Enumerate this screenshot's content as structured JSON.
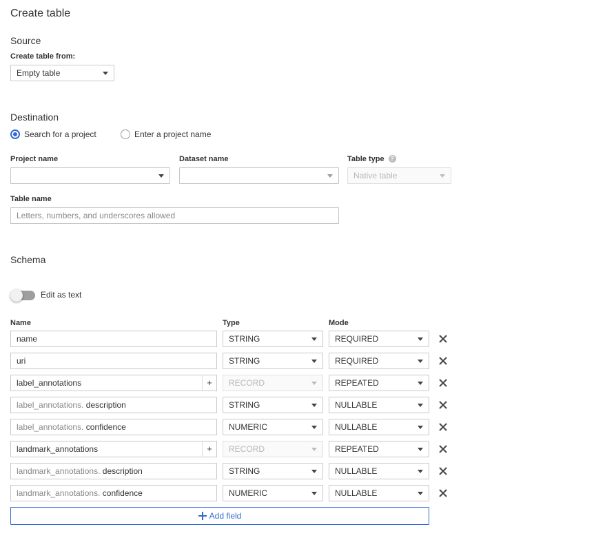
{
  "page": {
    "title": "Create table"
  },
  "source": {
    "heading": "Source",
    "create_from_label": "Create table from:",
    "create_from_value": "Empty table"
  },
  "destination": {
    "heading": "Destination",
    "radio_search": "Search for a project",
    "radio_enter": "Enter a project name",
    "project_label": "Project name",
    "dataset_label": "Dataset name",
    "table_type_label": "Table type",
    "table_type_value": "Native table",
    "table_name_label": "Table name",
    "table_name_placeholder": "Letters, numbers, and underscores allowed"
  },
  "schema": {
    "heading": "Schema",
    "edit_as_text": "Edit as text",
    "columns": {
      "name": "Name",
      "type": "Type",
      "mode": "Mode"
    },
    "rows": [
      {
        "prefix": "",
        "name": "name",
        "type": "STRING",
        "mode": "REQUIRED"
      },
      {
        "prefix": "",
        "name": "uri",
        "type": "STRING",
        "mode": "REQUIRED"
      },
      {
        "prefix": "",
        "name": "label_annotations",
        "type": "RECORD",
        "mode": "REPEATED"
      },
      {
        "prefix": "label_annotations.",
        "name": "description",
        "type": "STRING",
        "mode": "NULLABLE"
      },
      {
        "prefix": "label_annotations.",
        "name": "confidence",
        "type": "NUMERIC",
        "mode": "NULLABLE"
      },
      {
        "prefix": "",
        "name": "landmark_annotations",
        "type": "RECORD",
        "mode": "REPEATED"
      },
      {
        "prefix": "landmark_annotations.",
        "name": "description",
        "type": "STRING",
        "mode": "NULLABLE"
      },
      {
        "prefix": "landmark_annotations.",
        "name": "confidence",
        "type": "NUMERIC",
        "mode": "NULLABLE"
      }
    ],
    "add_field": "Add field",
    "nested_add": "+"
  },
  "colors": {
    "accent": "#3367d6",
    "border": "#c8c8c8",
    "muted": "#888888"
  }
}
